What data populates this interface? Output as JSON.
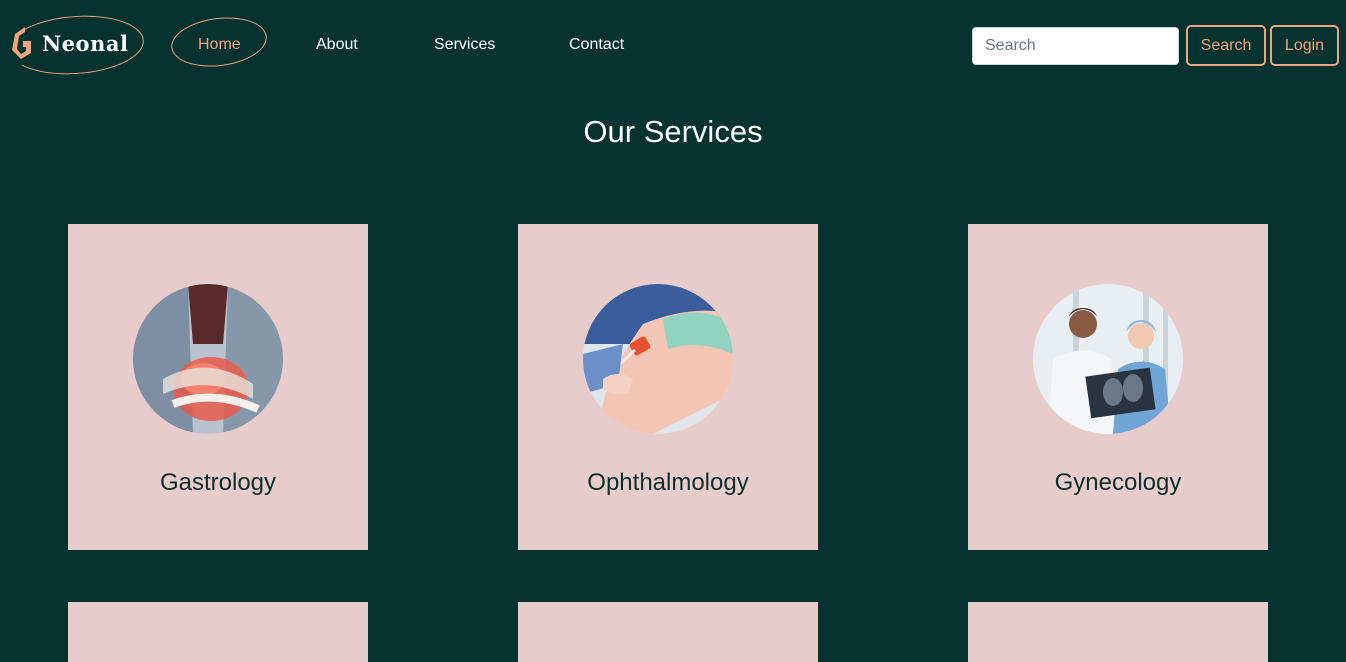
{
  "brand": {
    "name": "Neonal",
    "accent_color": "#f0a57c",
    "background_color": "#063230",
    "card_color": "#e8cccc"
  },
  "nav": {
    "items": [
      {
        "label": "Home",
        "active": true
      },
      {
        "label": "About",
        "active": false
      },
      {
        "label": "Services",
        "active": false
      },
      {
        "label": "Contact",
        "active": false
      }
    ]
  },
  "search": {
    "placeholder": "Search",
    "value": "",
    "button_label": "Search"
  },
  "login": {
    "label": "Login"
  },
  "main": {
    "title": "Our Services",
    "services": [
      {
        "title": "Gastrology",
        "image_icon": "stomach-photo"
      },
      {
        "title": "Ophthalmology",
        "image_icon": "knee-reflex-photo"
      },
      {
        "title": "Gynecology",
        "image_icon": "doctors-xray-photo"
      }
    ]
  }
}
